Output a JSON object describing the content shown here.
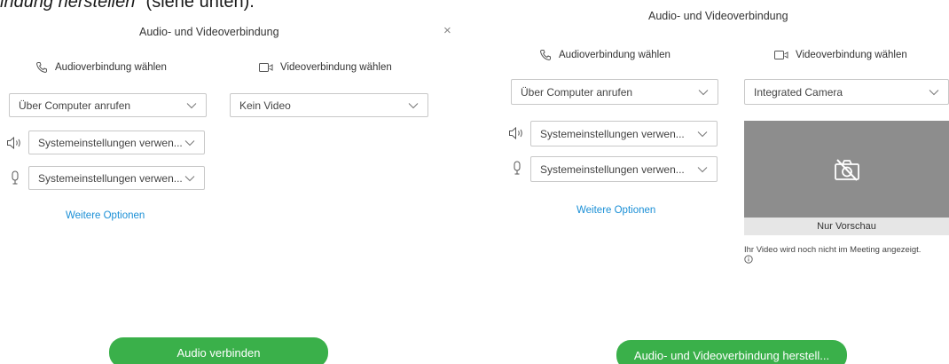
{
  "caption": {
    "italic": "indung herstellen",
    "rest": "“ (siehe unten)."
  },
  "left_panel": {
    "title": "Audio- und Videoverbindung",
    "close_symbol": "×",
    "audio_heading": "Audioverbindung wählen",
    "video_heading": "Videoverbindung wählen",
    "audio_select": "Über Computer anrufen",
    "video_select": "Kein Video",
    "speaker_select": "Systemeinstellungen verwen...",
    "mic_select": "Systemeinstellungen verwen...",
    "more_options": "Weitere Optionen",
    "primary_button": "Audio verbinden"
  },
  "right_panel": {
    "title": "Audio- und Videoverbindung",
    "audio_heading": "Audioverbindung wählen",
    "video_heading": "Videoverbindung wählen",
    "audio_select": "Über Computer anrufen",
    "video_select": "Integrated Camera",
    "speaker_select": "Systemeinstellungen verwen...",
    "mic_select": "Systemeinstellungen verwen...",
    "more_options": "Weitere Optionen",
    "preview_label": "Nur Vorschau",
    "preview_note": "Ihr Video wird noch nicht im Meeting angezeigt.",
    "primary_button": "Audio- und Videoverbindung herstell..."
  },
  "icons": {
    "phone": "phone-icon",
    "camera": "video-camera-icon",
    "chevron": "chevron-down-icon",
    "speaker": "speaker-icon",
    "microphone": "microphone-icon",
    "camera_off": "camera-off-icon",
    "info": "info-icon",
    "close": "close-icon"
  },
  "colors": {
    "accent_green": "#3ab04a",
    "link_blue": "#1a8fd6",
    "preview_gray": "#8d8d8d",
    "border": "#c8c8c8"
  }
}
